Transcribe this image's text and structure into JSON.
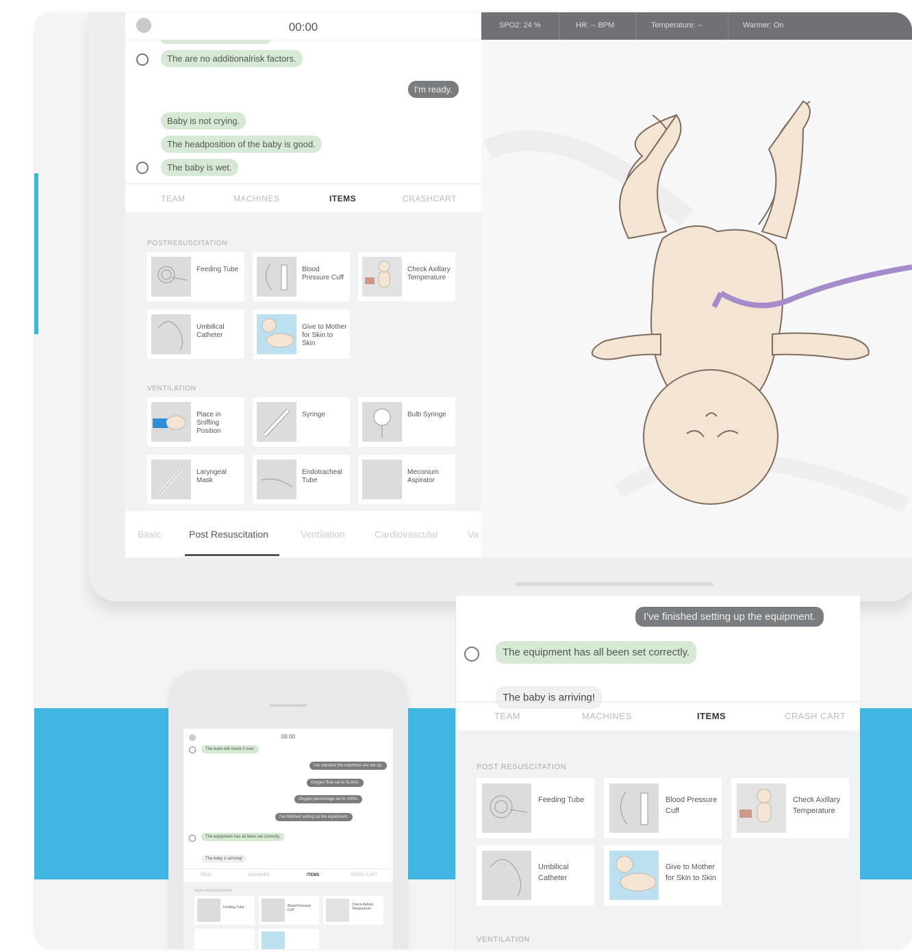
{
  "timer": "00:00",
  "chat": [
    {
      "text": "The are no additionalrisk factors.",
      "side": "left",
      "avatar": true
    },
    {
      "text": "I'm ready.",
      "side": "right"
    },
    {
      "text": "Baby is not crying.",
      "side": "left",
      "avatar": false
    },
    {
      "text": "The headposition of the baby is good.",
      "side": "left",
      "avatar": false
    },
    {
      "text": "The baby is wet.",
      "side": "left",
      "avatar": true
    }
  ],
  "tabs": [
    "TEAM",
    "MACHINES",
    "ITEMS",
    "CRASHCART"
  ],
  "active_tab": "ITEMS",
  "sections": {
    "post": "POSTRESUSCITATION",
    "vent": "VENTILATION"
  },
  "post_items": [
    "Feeding Tube",
    "Blood Pressure Cuff",
    "Check Axillary Temperature",
    "Umbilical Catheter",
    "Give to Mother for Skin to Skin"
  ],
  "vent_items": [
    "Place in Sniffing Position",
    "Syringe",
    "Bulb Syringe",
    "Laryngeal Mask",
    "Endotracheal Tube",
    "Meconium Aspirator"
  ],
  "bottom_tabs": [
    "Basic",
    "Post Resuscitation",
    "Ventilation",
    "Cardiovascular",
    "Va"
  ],
  "vitals": [
    "SPO2: 24 %",
    "HR: -- BPM",
    "Temperature: --",
    "Warmer: On"
  ],
  "phone": {
    "timer": "00:00",
    "chat": [
      {
        "text": "The team will check it over.",
        "style": "g"
      },
      {
        "text": "I've checked the machines are set up.",
        "style": "d"
      },
      {
        "text": "Oxygen flow set to 5L/min.",
        "style": "d"
      },
      {
        "text": "Oxygen percentage set to 100%.",
        "style": "d"
      },
      {
        "text": "I've finished setting up the equipment.",
        "style": "d"
      },
      {
        "text": "The equipment has all been set correctly.",
        "style": "g"
      },
      {
        "text": "The baby is arriving!",
        "style": "w"
      }
    ],
    "tabs": [
      "TEAM",
      "MACHINES",
      "ITEMS",
      "CRASH CART"
    ],
    "section": "POST RESUSCITATION",
    "items": [
      "Feeding Tube",
      "Blood Pressure Cuff",
      "Check Axillary Temperature"
    ]
  },
  "tablet2": {
    "top_bubble": "I've finished setting up the equipment.",
    "chat1": "The equipment has all been set correctly.",
    "chat2": "The baby is arriving!",
    "tabs": [
      "TEAM",
      "MACHINES",
      "ITEMS",
      "CRASH CART"
    ],
    "section": "POST RESUSCITATION",
    "items": [
      "Feeding Tube",
      "Blood Pressure Cuff",
      "Check Axillary Temperature",
      "Umbilical Catheter",
      "Give to Mother for Skin to Skin"
    ],
    "section2": "VENTILATION"
  },
  "colors": {
    "accent": "#42b6e2",
    "bubble_green": "#d6e9d4",
    "bubble_dark": "#7a7d80",
    "skin": "#f3e4d3",
    "cord": "#a48bc9"
  }
}
